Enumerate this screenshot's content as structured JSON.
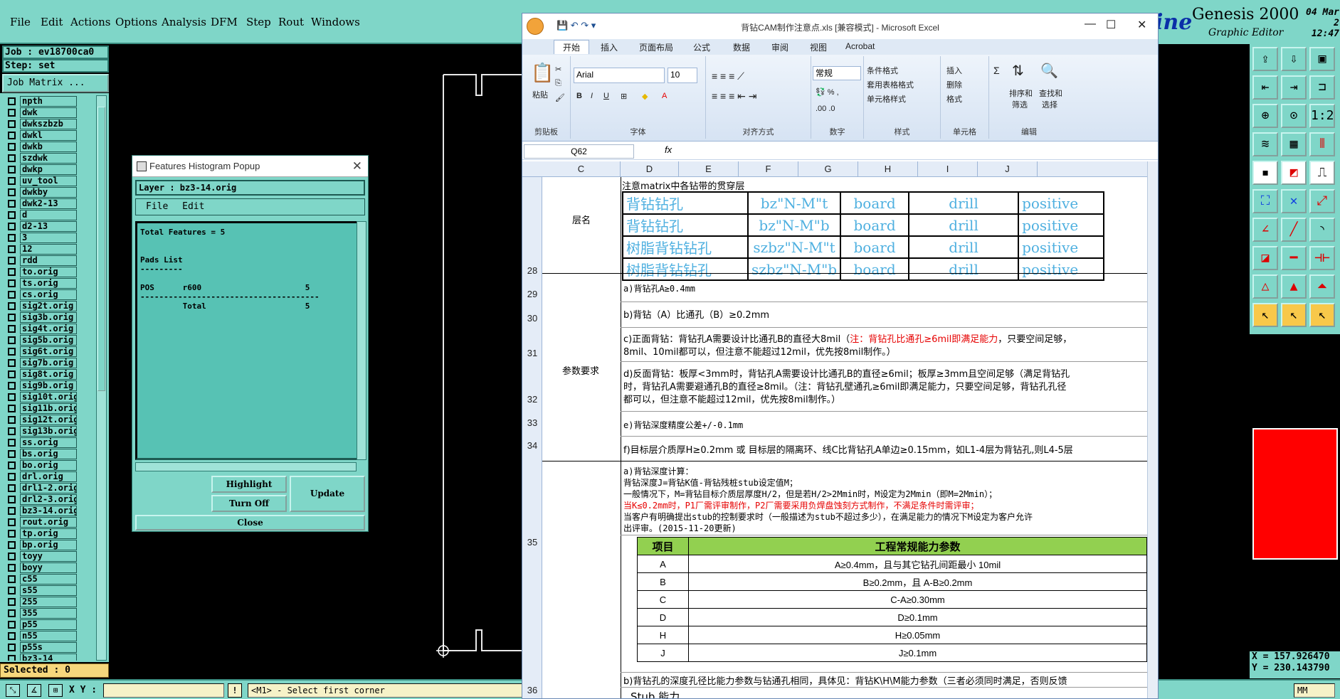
{
  "menu": [
    "File",
    "Edit",
    "Actions",
    "Options",
    "Analysis",
    "DFM",
    "Step",
    "Rout",
    "Windows"
  ],
  "job_label": "Job : ev18700ca0",
  "step_label": "Step: set",
  "job_matrix": "Job Matrix ...",
  "layers": [
    "npth",
    "dwk",
    "dwkszbzb",
    "dwkl",
    "dwkb",
    "szdwk",
    "dwkp",
    "uv_tool",
    "dwkby",
    "dwk2-13",
    "d",
    "d2-13",
    "3",
    "12",
    "rdd",
    "to.orig",
    "ts.orig",
    "cs.orig",
    "sig2t.orig",
    "sig3b.orig",
    "sig4t.orig",
    "sig5b.orig",
    "sig6t.orig",
    "sig7b.orig",
    "sig8t.orig",
    "sig9b.orig",
    "sig10t.orig",
    "sig11b.orig",
    "sig12t.orig",
    "sig13b.orig",
    "ss.orig",
    "bs.orig",
    "bo.orig",
    "drl.orig",
    "drl1-2.orig",
    "drl2-3.orig",
    "bz3-14.orig",
    "rout.orig",
    "tp.orig",
    "bp.orig",
    "toyy",
    "boyy",
    "c55",
    "s55",
    "255",
    "355",
    "p55",
    "n55",
    "p55s",
    "bz3-14"
  ],
  "selected": "Selected : 0",
  "xy_label": "X Y :",
  "prompt": "<M1> - Select first corner",
  "units": "MM",
  "brand": {
    "logo": "ine",
    "title": "Genesis 2000",
    "subtitle": "Graphic Editor",
    "date": "04 Mar 2",
    "time": "12:47"
  },
  "coords": {
    "x": "X = 157.926470",
    "y": "Y = 230.143790"
  },
  "popup": {
    "title": "Features Histogram Popup",
    "layer": "Layer :  bz3-14.orig",
    "menu_file": "File",
    "menu_edit": "Edit",
    "text": "Total Features = 5\n\n\nPads List\n---------\n\nPOS      r600                      5\n--------------------------------------\n         Total                     5",
    "highlight": "Highlight",
    "turn_off": "Turn Off",
    "update": "Update",
    "close": "Close"
  },
  "excel": {
    "title": "背钻CAM制作注意点.xls  [兼容模式] - Microsoft Excel",
    "tabs": [
      "开始",
      "插入",
      "页面布局",
      "公式",
      "数据",
      "审阅",
      "视图",
      "Acrobat"
    ],
    "ribbon": {
      "paste": "粘贴",
      "clipboard": "剪贴板",
      "font_name": "Arial",
      "font_size": "10",
      "font_group": "字体",
      "align_group": "对齐方式",
      "number_format": "常规",
      "number_group": "数字",
      "cond_format": "条件格式",
      "table_format": "套用表格格式",
      "cell_style": "单元格样式",
      "style_group": "样式",
      "insert": "插入",
      "delete": "删除",
      "format": "格式",
      "cells_group": "单元格",
      "sort": "排序和",
      "filter": "筛选",
      "find": "查找和",
      "select": "选择",
      "edit_group": "编辑"
    },
    "name_box": "Q62",
    "fx": "fx",
    "columns": [
      "C",
      "D",
      "E",
      "F",
      "G",
      "H",
      "I",
      "J"
    ],
    "rows": [
      "28",
      "29",
      "30",
      "31",
      "32",
      "33",
      "34",
      "35",
      "36"
    ],
    "r28_header": "注意matrix中各钻带的贯穿层",
    "layer_name": "层名",
    "matrix": [
      [
        "背钻钻孔",
        "bz\"N-M\"t",
        "board",
        "drill",
        "positive"
      ],
      [
        "背钻钻孔",
        "bz\"N-M\"b",
        "board",
        "drill",
        "positive"
      ],
      [
        "树脂背钻钻孔",
        "szbz\"N-M\"t",
        "board",
        "drill",
        "positive"
      ],
      [
        "树脂背钻钻孔",
        "szbz\"N-M\"b",
        "board",
        "drill",
        "positive"
      ]
    ],
    "param_label": "参数要求",
    "r29": "a)背钻孔A≥0.4mm",
    "r30": "b)背钻（A）比通孔（B）≥0.2mm",
    "r31_a": "c)正面背钻：背钻孔A需要设计比通孔B的直径大8mil（",
    "r31_red": "注：背钻孔比通孔≥6mil即满足能力",
    "r31_b": "，只要空间足够，",
    "r31_c": "8mil、10mil都可以，但注意不能超过12mil，优先按8mil制作。）",
    "r32_a": "d)反面背钻：板厚<3mm时，背钻孔A需要设计比通孔B的直径≥6mil；板厚≥3mm且空间足够（满足背钻孔",
    "r32_b": "时，背钻孔A需要避通孔B的直径≥8mil。（注：背钻孔壁通孔≥6mil即满足能力，只要空间足够，背钻孔孔径",
    "r32_c": "都可以，但注意不能超过12mil，优先按8mil制作。）",
    "r33": "e)背钻深度精度公差+/-0.1mm",
    "r34": "f)目标层介质厚H≥0.2mm 或 目标层的隔离环、线C比背钻孔A单边≥0.15mm，如L1-4层为背钻孔,则L4-5层",
    "r35_1": "a)背钻深度计算：",
    "r35_2": "    背钻深度J=背钻K值-背钻残桩stub设定值M；",
    "r35_3": "一般情况下，M=背钻目标介质层厚度H/2，但是若H/2>2Mmin时，M设定为2Mmin（即M=2Mmin）；",
    "r35_4": "当K≤0.2mm时，P1厂需评审制作，P2厂需要采用负焊盘蚀刻方式制作，不满足条件时需评审；",
    "r35_5": "当客户有明确提出stub的控制要求时（一般描述为stub不超过多少），在满足能力的情况下M设定为客户允许",
    "r35_6": "出评审。(2015-11-20更新)",
    "cap_header": [
      "项目",
      "工程常规能力参数"
    ],
    "cap_rows": [
      [
        "A",
        "A≥0.4mm，且与其它钻孔间距最小 10mil"
      ],
      [
        "B",
        "B≥0.2mm，且 A-B≥0.2mm"
      ],
      [
        "C",
        "C-A≥0.30mm"
      ],
      [
        "D",
        "D≥0.1mm"
      ],
      [
        "H",
        "H≥0.05mm"
      ],
      [
        "J",
        "J≥0.1mm"
      ]
    ],
    "r36_b": "b)背钻孔的深度孔径比能力参数与钻通孔相同，具体见：背钻K\\H\\M能力参数（三者必须同时满足，否则反馈",
    "stub": "Stub 能力"
  }
}
